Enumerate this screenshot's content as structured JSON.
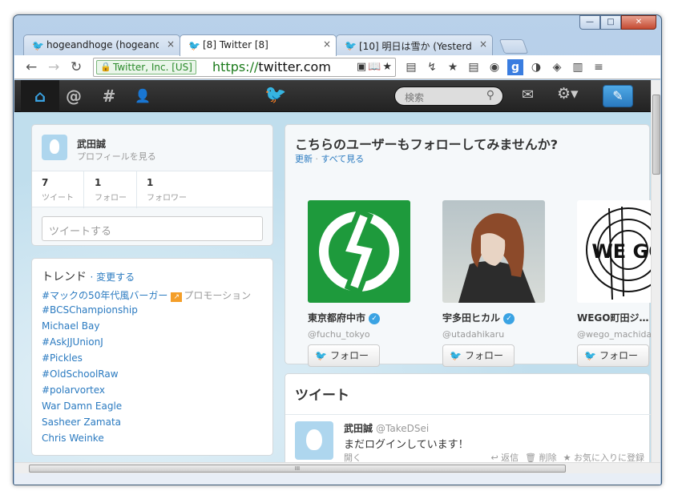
{
  "window": {
    "min": "—",
    "max": "□",
    "close": "✕"
  },
  "tabs": [
    {
      "label": "hogeandhoge (hogeandh",
      "close": "×"
    },
    {
      "label": "[8] Twitter [8]",
      "close": "×"
    },
    {
      "label": "[10] 明日は雪か (Yesterd",
      "close": "×"
    }
  ],
  "toolbar": {
    "back": "←",
    "forward": "→",
    "reload": "↻",
    "ev": "Twitter, Inc. [US]",
    "url_scheme": "https://",
    "url_domain": "twitter.com",
    "omni_icons": "▣📖★",
    "menu": "≡"
  },
  "ext_icons": [
    "▤",
    "↯",
    "★",
    "▤",
    "◉",
    "g",
    "◑",
    "◈",
    "▥"
  ],
  "twitter_nav": {
    "home": "⌂",
    "at": "@",
    "hash": "#",
    "person": "👤",
    "bird": "🐦",
    "search_placeholder": "検索",
    "search_icon": "⚲",
    "mail": "✉",
    "gear": "⚙▾",
    "compose": "✎"
  },
  "profile": {
    "name": "武田誠",
    "link": "プロフィールを見る",
    "stats": [
      {
        "n": "7",
        "l": "ツイート"
      },
      {
        "n": "1",
        "l": "フォロー"
      },
      {
        "n": "1",
        "l": "フォロワー"
      }
    ],
    "tweet_placeholder": "ツイートする"
  },
  "trends": {
    "title": "トレンド",
    "change": "· 変更する",
    "items": [
      "#マックの50年代風バーガー",
      "#BCSChampionship",
      "Michael Bay",
      "#AskJJUnionJ",
      "#Pickles",
      "#OldSchoolRaw",
      "#polarvortex",
      "War Damn Eagle",
      "Sasheer Zamata",
      "Chris Weinke"
    ],
    "promo_icon": "↗",
    "promo_label": "プロモーション"
  },
  "who": {
    "title": "こちらのユーザーもフォローしてみませんか?",
    "refresh": "更新",
    "dot": " · ",
    "view_all": "すべて見る",
    "follow": "フォロー",
    "verified": "✓",
    "suggestions": [
      {
        "name": "東京都府中市",
        "handle": "@fuchu_tokyo",
        "verified": true
      },
      {
        "name": "宇多田ヒカル",
        "handle": "@utadahikaru",
        "verified": true
      },
      {
        "name": "WEGO町田ジ…",
        "handle": "@wego_machida",
        "verified": false
      }
    ],
    "wego_text": "WE GO"
  },
  "tweets": {
    "title": "ツイート",
    "name": "武田誠",
    "handle": "@TakeDSei",
    "text": "まだログインしています！",
    "open": "開く",
    "reply": "↩ 返信",
    "delete": "🗑 削除",
    "fav": "★ お気に入りに登録"
  },
  "hscroll": "III"
}
